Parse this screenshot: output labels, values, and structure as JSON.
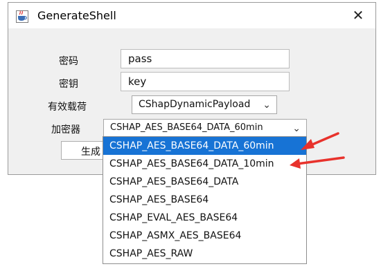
{
  "window": {
    "title": "GenerateShell",
    "close_glyph": "✕"
  },
  "form": {
    "password_label": "密码",
    "password_value": "pass",
    "key_label": "密钥",
    "key_value": "key",
    "payload_label": "有效载荷",
    "payload_value": "CShapDynamicPayload",
    "encryptor_label": "加密器",
    "encryptor_value": "CSHAP_AES_BASE64_DATA_60min",
    "generate_button": "生成"
  },
  "dropdown": {
    "options": [
      "CSHAP_AES_BASE64_DATA_60min",
      "CSHAP_AES_BASE64_DATA_10min",
      "CSHAP_AES_BASE64_DATA",
      "CSHAP_AES_BASE64",
      "CSHAP_EVAL_AES_BASE64",
      "CSHAP_ASMX_AES_BASE64",
      "CSHAP_AES_RAW"
    ],
    "selected_index": 0
  },
  "colors": {
    "selection": "#1773d5",
    "annotation_arrow": "#e8322c"
  },
  "icons": {
    "app": "java-cup-icon",
    "chevron": "chevron-down-icon",
    "close": "close-icon"
  }
}
